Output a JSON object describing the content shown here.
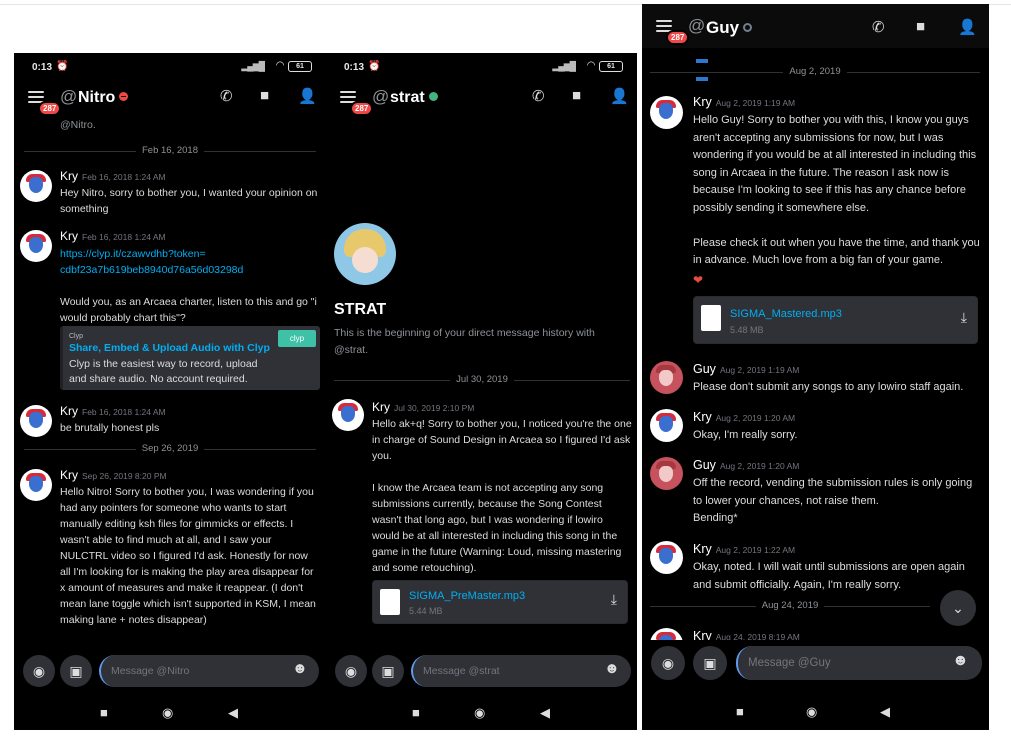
{
  "phone1": {
    "status": {
      "time": "0:13",
      "battery": "61"
    },
    "header": {
      "badge": "287",
      "at": "@",
      "name": "Nitro"
    },
    "partial_top": "@Nitro.",
    "dividers": [
      "Feb 16, 2018",
      "Sep 26, 2019"
    ],
    "messages": [
      {
        "author": "Kry",
        "time": "Feb 16, 2018 1:24 AM",
        "text": "Hey Nitro, sorry to bother you, I wanted your opinion on something"
      },
      {
        "author": "Kry",
        "time": "Feb 16, 2018 1:24 AM",
        "link": "https://clyp.it/czawvdhb?token=\ncdbf23a7b619beb8940d76a56d03298d",
        "text": "Would you, as an Arcaea charter, listen to this and go \"i would probably chart this\"?"
      },
      {
        "author": "Kry",
        "time": "Feb 16, 2018 1:24 AM",
        "text": "be brutally honest pls"
      },
      {
        "author": "Kry",
        "time": "Sep 26, 2019 8:20 PM",
        "text": "Hello Nitro! Sorry to bother you, I was wondering if you had any pointers for someone who wants to start manually editing ksh files for gimmicks or effects. I wasn't able to find much at all, and I saw your NULCTRL video so I figured I'd ask. Honestly for now all I'm looking for is making the play area disappear for x amount of measures and make it reappear. (I don't mean lane toggle which isn't supported in KSM, I mean making lane + notes disappear)"
      }
    ],
    "embed": {
      "provider": "Clyp",
      "title": "Share, Embed & Upload Audio with Clyp",
      "description": "Clyp is the easiest way to record, upload and share audio. No account required.",
      "badge": "clyp"
    },
    "composer": {
      "placeholder": "Message @Nitro"
    }
  },
  "phone2": {
    "status": {
      "time": "0:13",
      "battery": "61"
    },
    "header": {
      "badge": "287",
      "at": "@",
      "name": "strat"
    },
    "intro": {
      "title": "STRAT",
      "text": "This is the beginning of your direct message history with @strat."
    },
    "dividers": [
      "Jul 30, 2019"
    ],
    "messages": [
      {
        "author": "Kry",
        "time": "Jul 30, 2019 2:10 PM",
        "text": "Hello ak+q! Sorry to bother you, I noticed you're the one in charge of Sound Design in Arcaea so I figured I'd ask you.\n\nI know the Arcaea team is not accepting any song submissions currently, because the Song Contest wasn't that long ago, but I was wondering if lowiro would be at all interested in including this song in the game in the future (Warning: Loud, missing mastering and some retouching)."
      }
    ],
    "file": {
      "name": "SIGMA_PreMaster.mp3",
      "size": "5.44 MB"
    },
    "composer": {
      "placeholder": "Message @strat"
    }
  },
  "phone3": {
    "header": {
      "badge": "287",
      "at": "@",
      "name": "Guy"
    },
    "dividers": [
      "Aug 2, 2019",
      "Aug 24, 2019"
    ],
    "messages": [
      {
        "author": "Kry",
        "time": "Aug 2, 2019 1:19 AM",
        "text": "Hello Guy! Sorry to bother you with this, I know you guys aren't accepting any submissions for now, but I was wondering if you would be at all interested in including this song in Arcaea in the future. The reason I ask now is because I'm looking to see if this has any chance before possibly sending it somewhere else.\n\nPlease check it out when you have the time, and thank you in advance. Much love from a big fan of your game."
      },
      {
        "author": "Guy",
        "time": "Aug 2, 2019 1:19 AM",
        "text": "Please don't submit any songs to any lowiro staff again."
      },
      {
        "author": "Kry",
        "time": "Aug 2, 2019 1:20 AM",
        "text": "Okay, I'm really sorry."
      },
      {
        "author": "Guy",
        "time": "Aug 2, 2019 1:20 AM",
        "text": "Off the record, vending the submission rules is only going to lower your chances, not raise them.\nBending*"
      },
      {
        "author": "Kry",
        "time": "Aug 2, 2019 1:22 AM",
        "text": "Okay, noted. I will wait until submissions are open again and submit officially. Again, I'm really sorry."
      },
      {
        "author": "Kry",
        "time": "Aug 24, 2019 8:19 AM",
        "text": ""
      }
    ],
    "file": {
      "name": "SIGMA_Mastered.mp3",
      "size": "5.48 MB"
    },
    "composer": {
      "placeholder": "Message @Guy"
    }
  },
  "icons": {
    "call": "phone-call-icon",
    "video": "video-icon",
    "members": "members-icon",
    "camera": "camera-icon",
    "image": "image-icon",
    "emoji": "emoji-icon",
    "download": "download-icon"
  },
  "colors": {
    "background": "#000000",
    "link": "#00aff4",
    "online": "#43b581",
    "dnd": "#f04747",
    "badge": "#f04747"
  }
}
